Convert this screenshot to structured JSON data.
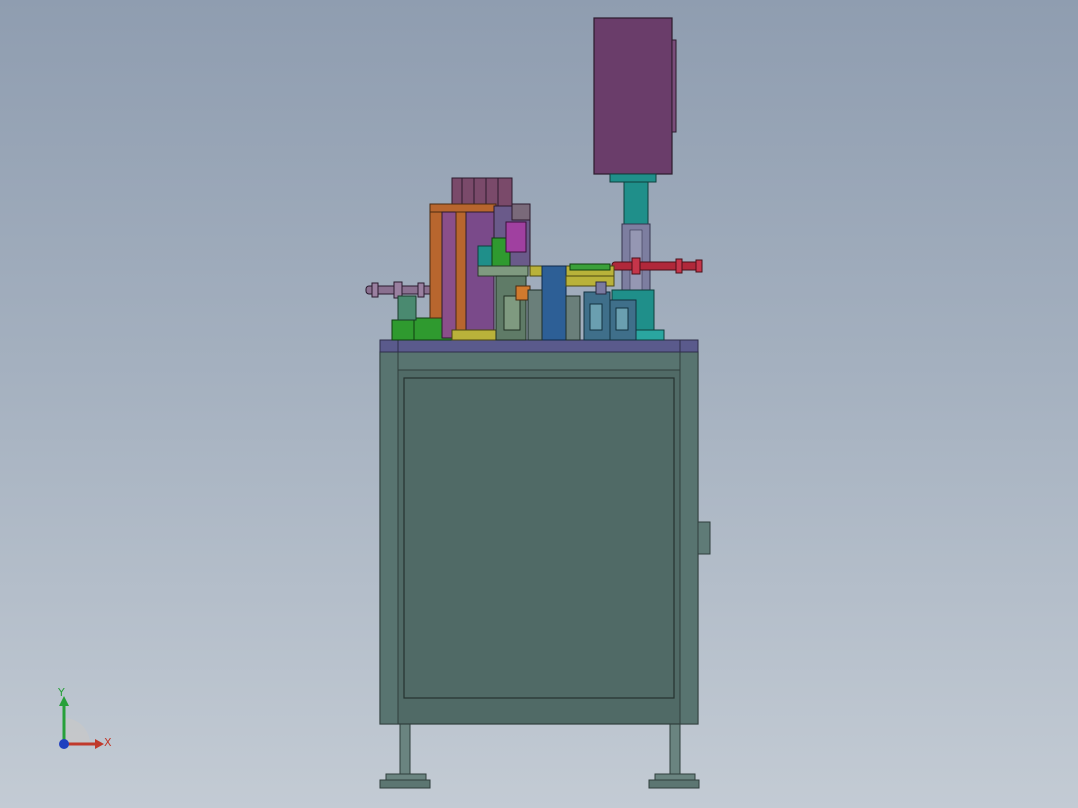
{
  "scene": {
    "background": [
      "#8f9db0",
      "#c3cbd4"
    ],
    "model_colors": {
      "cabinet": "#506a66",
      "cabinet_edge": "#2f3e3c",
      "tabletop": "#5a5a8c",
      "motor_housing": "#6a3d6a",
      "cylinder": "#1f8f8a",
      "red_rod": "#b0283a",
      "green_blocks": "#2f9a2f",
      "orange_frame": "#b8662e",
      "yellow_rail": "#b9b23a",
      "blue_block": "#2d5f96"
    }
  },
  "triad": {
    "x_label": "X",
    "y_label": "Y",
    "x_color": "#c0392b",
    "y_color": "#27a03a",
    "z_color": "#1f3fbf"
  }
}
